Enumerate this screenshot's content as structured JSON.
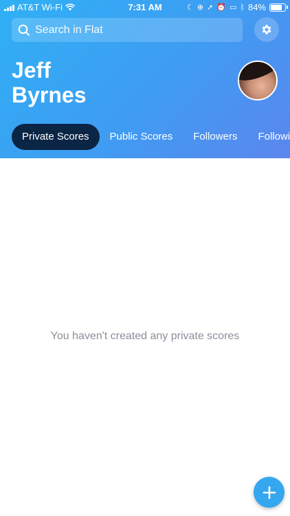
{
  "status_bar": {
    "carrier": "AT&T Wi-Fi",
    "time": "7:31 AM",
    "battery": "84%",
    "battery_level": 0.84
  },
  "search": {
    "placeholder": "Search in Flat"
  },
  "profile": {
    "first_name": "Jeff",
    "last_name": "Byrnes"
  },
  "tabs": [
    {
      "label": "Private Scores",
      "active": true
    },
    {
      "label": "Public Scores",
      "active": false
    },
    {
      "label": "Followers",
      "active": false
    },
    {
      "label": "Following",
      "active": false
    }
  ],
  "main": {
    "empty_message": "You haven't created any private scores"
  },
  "colors": {
    "header_gradient_start": "#2fb0f5",
    "header_gradient_end": "#5b86ee",
    "active_tab": "#0b2545",
    "fab": "#35a7ef"
  },
  "icons": {
    "search": "search-icon",
    "settings": "gear-icon",
    "fab": "plus-icon"
  }
}
